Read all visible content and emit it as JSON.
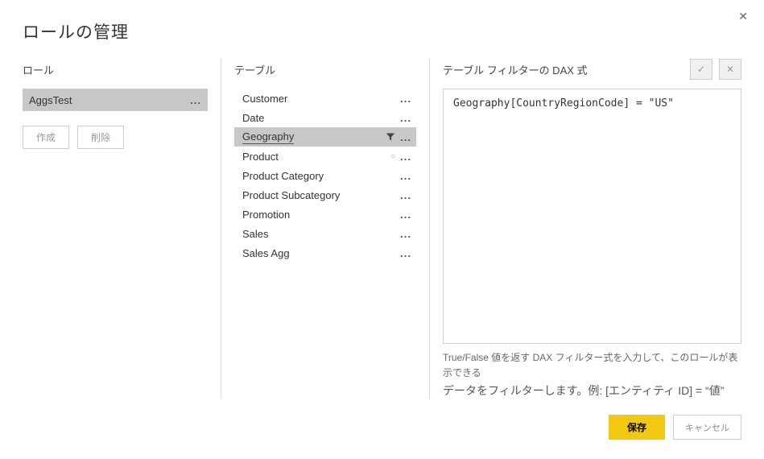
{
  "dialog": {
    "title": "ロールの管理",
    "close_x": "✕"
  },
  "roles_section": {
    "header": "ロール",
    "items": [
      {
        "name": "AggsTest"
      }
    ],
    "create_label": "作成",
    "delete_label": "削除"
  },
  "tables_section": {
    "header": "テーブル",
    "items": [
      {
        "name": "Customer",
        "selected": false,
        "has_filter": false
      },
      {
        "name": "Date",
        "selected": false,
        "has_filter": false
      },
      {
        "name": "Geography",
        "selected": true,
        "has_filter": true
      },
      {
        "name": "Product",
        "selected": false,
        "has_filter": false,
        "dot": true
      },
      {
        "name": "Product Category",
        "selected": false,
        "has_filter": false
      },
      {
        "name": "Product Subcategory",
        "selected": false,
        "has_filter": false
      },
      {
        "name": "Promotion",
        "selected": false,
        "has_filter": false
      },
      {
        "name": "Sales",
        "selected": false,
        "has_filter": false
      },
      {
        "name": "Sales Agg",
        "selected": false,
        "has_filter": false
      }
    ]
  },
  "dax_section": {
    "header": "テーブル フィルターの DAX 式",
    "check_label": "✓",
    "x_label": "✕",
    "expression": "Geography[CountryRegionCode] = \"US\"",
    "help_line1": "True/False 値を返す DAX フィルター式を入力して、このロールが表示できる",
    "help_line2": "データをフィルターします。例: [エンティティ ID] = “値”"
  },
  "footer": {
    "save_label": "保存",
    "cancel_label": "キャンセル"
  },
  "ellipsis": "..."
}
